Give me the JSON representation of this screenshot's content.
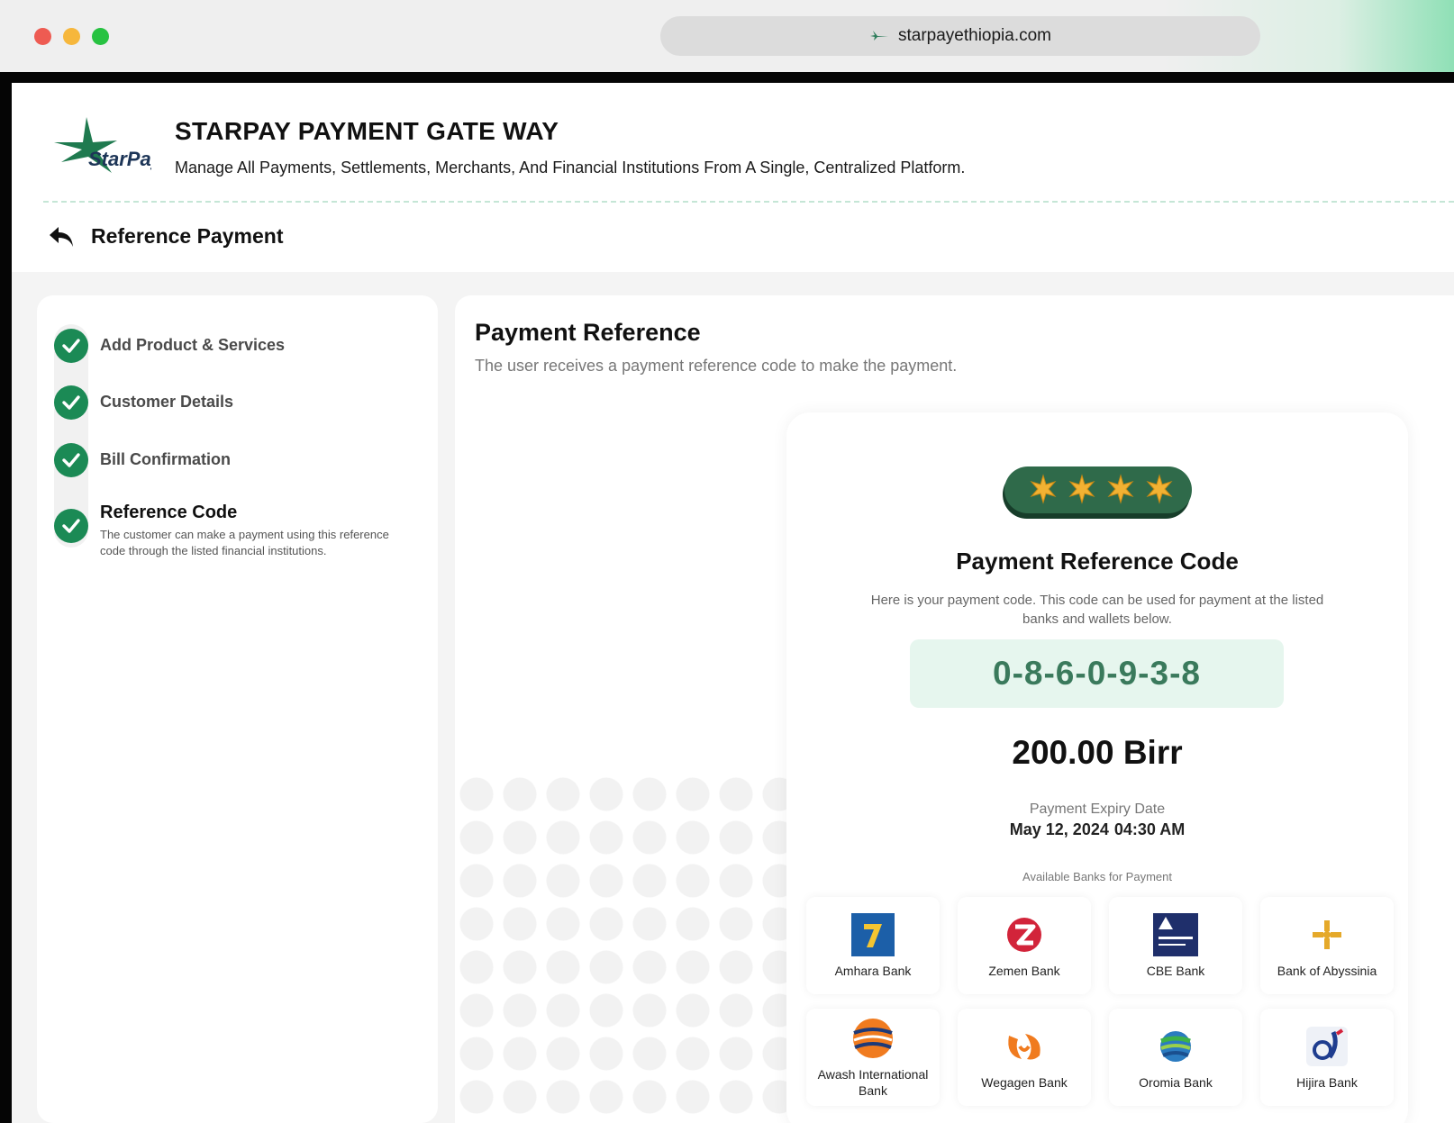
{
  "browser": {
    "url": "starpayethiopia.com",
    "dots": {
      "close": "#ee5b52",
      "minimize": "#f6b73c",
      "maximize": "#27c241"
    }
  },
  "header": {
    "logo_text": "StarPay",
    "title": "STARPAY PAYMENT GATE WAY",
    "subtitle": "Manage All Payments, Settlements, Merchants, And Financial Institutions From A Single, Centralized Platform."
  },
  "page": {
    "title": "Reference Payment"
  },
  "steps": [
    {
      "label": "Add Product & Services",
      "status": "complete"
    },
    {
      "label": "Customer Details",
      "status": "complete"
    },
    {
      "label": "Bill Confirmation",
      "status": "complete"
    },
    {
      "label": "Reference Code",
      "status": "active",
      "description": "The customer can make a payment using this reference code through the listed financial institutions."
    }
  ],
  "main": {
    "title": "Payment Reference",
    "subtitle": "The user receives a payment reference code to make the payment."
  },
  "reference": {
    "title": "Payment Reference Code",
    "description": "Here is your payment code. This code can be used for payment at the listed banks and wallets below.",
    "code": "0-8-6-0-9-3-8",
    "amount": "200.00 Birr",
    "expiry_label": "Payment Expiry Date",
    "expiry_date": "May 12, 2024",
    "expiry_time": "04:30 AM",
    "banks_label": "Available Banks for Payment"
  },
  "banks": [
    {
      "name": "Amhara Bank",
      "icon": "amhara-bank-logo"
    },
    {
      "name": "Zemen Bank",
      "icon": "zemen-bank-logo"
    },
    {
      "name": "CBE Bank",
      "icon": "cbe-bank-logo"
    },
    {
      "name": "Bank of Abyssinia",
      "icon": "abyssinia-bank-logo"
    },
    {
      "name": "Awash International Bank",
      "icon": "awash-bank-logo"
    },
    {
      "name": "Wegagen Bank",
      "icon": "wegagen-bank-logo"
    },
    {
      "name": "Oromia Bank",
      "icon": "oromia-bank-logo"
    },
    {
      "name": "Hijira Bank",
      "icon": "hijira-bank-logo"
    }
  ],
  "colors": {
    "accent": "#1b8a55",
    "code_bg": "#e6f6ee",
    "code_text": "#3a7a5c"
  }
}
